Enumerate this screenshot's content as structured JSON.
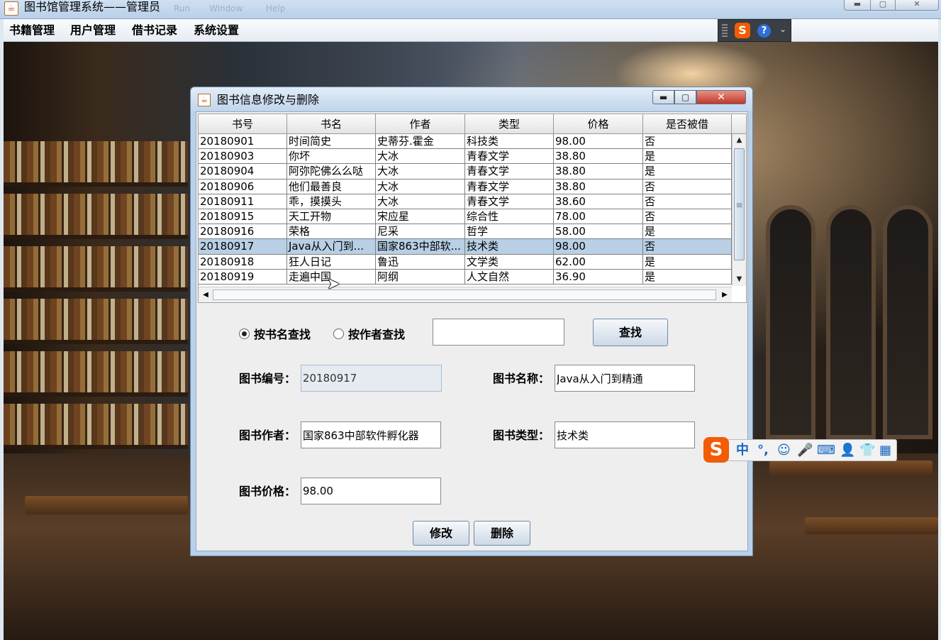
{
  "window": {
    "title": "图书馆管理系统——管理员",
    "ghost_menu": [
      "Run",
      "Window",
      "Help"
    ]
  },
  "menubar": {
    "items": [
      "书籍管理",
      "用户管理",
      "借书记录",
      "系统设置"
    ]
  },
  "ime_toolbar": {
    "logo": "S",
    "help": "?",
    "arrow": "⌄"
  },
  "dialog": {
    "title": "图书信息修改与删除",
    "table": {
      "columns": [
        "书号",
        "书名",
        "作者",
        "类型",
        "价格",
        "是否被借"
      ],
      "rows": [
        [
          "20180901",
          "时间简史",
          "史蒂芬.霍金",
          "科技类",
          "98.00",
          "否"
        ],
        [
          "20180903",
          "你坏",
          "大冰",
          "青春文学",
          "38.80",
          "是"
        ],
        [
          "20180904",
          "阿弥陀佛么么哒",
          "大冰",
          "青春文学",
          "38.80",
          "是"
        ],
        [
          "20180906",
          "他们最善良",
          "大冰",
          "青春文学",
          "38.80",
          "否"
        ],
        [
          "20180911",
          "乖，摸摸头",
          "大冰",
          "青春文学",
          "38.60",
          "否"
        ],
        [
          "20180915",
          "天工开物",
          "宋应星",
          "综合性",
          "78.00",
          "否"
        ],
        [
          "20180916",
          "荣格",
          "尼采",
          "哲学",
          "58.00",
          "是"
        ],
        [
          "20180917",
          "Java从入门到...",
          "国家863中部软...",
          "技术类",
          "98.00",
          "否"
        ],
        [
          "20180918",
          "狂人日记",
          "鲁迅",
          "文学类",
          "62.00",
          "是"
        ],
        [
          "20180919",
          "走遍中国",
          "阿纲",
          "人文自然",
          "36.90",
          "是"
        ]
      ],
      "selected_row": 7
    },
    "search": {
      "radio_by_name": "按书名查找",
      "radio_by_author": "按作者查找",
      "selected": "by_name",
      "query": "",
      "button": "查找"
    },
    "form": {
      "id_label": "图书编号：",
      "id_value": "20180917",
      "name_label": "图书名称：",
      "name_value": "Java从入门到精通",
      "author_label": "图书作者：",
      "author_value": "国家863中部软件孵化器",
      "type_label": "图书类型：",
      "type_value": "技术类",
      "price_label": "图书价格：",
      "price_value": "98.00"
    },
    "buttons": {
      "modify": "修改",
      "delete": "删除"
    }
  },
  "ime_float": {
    "logo": "S",
    "items": [
      "中",
      "°,",
      "☺",
      "🎤",
      "⌨",
      "👤",
      "👕",
      "▦"
    ]
  },
  "colors": {
    "selected_row": "#b8cfe5",
    "sogou_orange": "#f25c05"
  }
}
